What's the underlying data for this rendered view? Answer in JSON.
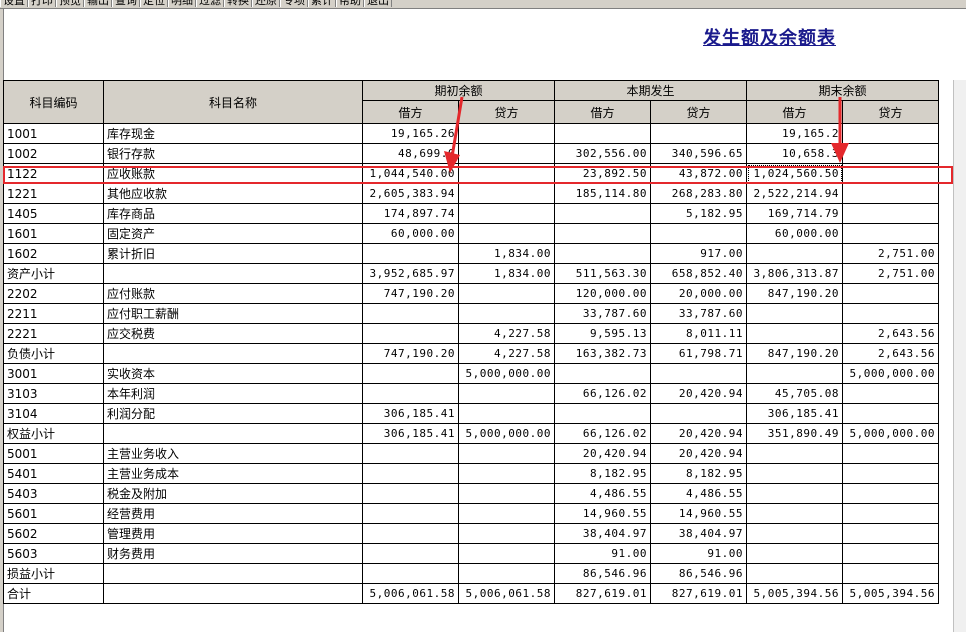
{
  "toolbar": {
    "buttons": [
      "设置",
      "打印",
      "预览",
      "输出",
      "查询",
      "定位",
      "明细",
      "过滤",
      "转换",
      "还原",
      "专项",
      "累计",
      "帮助",
      "退出"
    ]
  },
  "report": {
    "title": "发生额及余额表"
  },
  "table": {
    "headers": {
      "code": "科目编码",
      "name": "科目名称",
      "opening": "期初余额",
      "current": "本期发生",
      "closing": "期末余额",
      "debit": "借方",
      "credit": "贷方"
    },
    "rows": [
      {
        "code": "1001",
        "name": "库存现金",
        "od": "19,165.26",
        "oc": "",
        "cd": "",
        "cc": "",
        "ed": "19,165.2",
        "ec": ""
      },
      {
        "code": "1002",
        "name": "银行存款",
        "od": "48,699.0",
        "oc": "",
        "cd": "302,556.00",
        "cc": "340,596.65",
        "ed": "10,658.3",
        "ec": ""
      },
      {
        "code": "1122",
        "name": "应收账款",
        "od": "1,044,540.00",
        "oc": "",
        "cd": "23,892.50",
        "cc": "43,872.00",
        "ed": "1,024,560.50",
        "ec": ""
      },
      {
        "code": "1221",
        "name": "其他应收款",
        "od": "2,605,383.94",
        "oc": "",
        "cd": "185,114.80",
        "cc": "268,283.80",
        "ed": "2,522,214.94",
        "ec": ""
      },
      {
        "code": "1405",
        "name": "库存商品",
        "od": "174,897.74",
        "oc": "",
        "cd": "",
        "cc": "5,182.95",
        "ed": "169,714.79",
        "ec": ""
      },
      {
        "code": "1601",
        "name": "固定资产",
        "od": "60,000.00",
        "oc": "",
        "cd": "",
        "cc": "",
        "ed": "60,000.00",
        "ec": ""
      },
      {
        "code": "1602",
        "name": "累计折旧",
        "od": "",
        "oc": "1,834.00",
        "cd": "",
        "cc": "917.00",
        "ed": "",
        "ec": "2,751.00"
      },
      {
        "code": "资产小计",
        "name": "",
        "od": "3,952,685.97",
        "oc": "1,834.00",
        "cd": "511,563.30",
        "cc": "658,852.40",
        "ed": "3,806,313.87",
        "ec": "2,751.00"
      },
      {
        "code": "2202",
        "name": "应付账款",
        "od": "747,190.20",
        "oc": "",
        "cd": "120,000.00",
        "cc": "20,000.00",
        "ed": "847,190.20",
        "ec": ""
      },
      {
        "code": "2211",
        "name": "应付职工薪酬",
        "od": "",
        "oc": "",
        "cd": "33,787.60",
        "cc": "33,787.60",
        "ed": "",
        "ec": ""
      },
      {
        "code": "2221",
        "name": "应交税费",
        "od": "",
        "oc": "4,227.58",
        "cd": "9,595.13",
        "cc": "8,011.11",
        "ed": "",
        "ec": "2,643.56"
      },
      {
        "code": "负债小计",
        "name": "",
        "od": "747,190.20",
        "oc": "4,227.58",
        "cd": "163,382.73",
        "cc": "61,798.71",
        "ed": "847,190.20",
        "ec": "2,643.56"
      },
      {
        "code": "3001",
        "name": "实收资本",
        "od": "",
        "oc": "5,000,000.00",
        "cd": "",
        "cc": "",
        "ed": "",
        "ec": "5,000,000.00"
      },
      {
        "code": "3103",
        "name": "本年利润",
        "od": "",
        "oc": "",
        "cd": "66,126.02",
        "cc": "20,420.94",
        "ed": "45,705.08",
        "ec": ""
      },
      {
        "code": "3104",
        "name": "利润分配",
        "od": "306,185.41",
        "oc": "",
        "cd": "",
        "cc": "",
        "ed": "306,185.41",
        "ec": ""
      },
      {
        "code": "权益小计",
        "name": "",
        "od": "306,185.41",
        "oc": "5,000,000.00",
        "cd": "66,126.02",
        "cc": "20,420.94",
        "ed": "351,890.49",
        "ec": "5,000,000.00"
      },
      {
        "code": "5001",
        "name": "主营业务收入",
        "od": "",
        "oc": "",
        "cd": "20,420.94",
        "cc": "20,420.94",
        "ed": "",
        "ec": ""
      },
      {
        "code": "5401",
        "name": "主营业务成本",
        "od": "",
        "oc": "",
        "cd": "8,182.95",
        "cc": "8,182.95",
        "ed": "",
        "ec": ""
      },
      {
        "code": "5403",
        "name": "税金及附加",
        "od": "",
        "oc": "",
        "cd": "4,486.55",
        "cc": "4,486.55",
        "ed": "",
        "ec": ""
      },
      {
        "code": "5601",
        "name": "经营费用",
        "od": "",
        "oc": "",
        "cd": "14,960.55",
        "cc": "14,960.55",
        "ed": "",
        "ec": ""
      },
      {
        "code": "5602",
        "name": "管理费用",
        "od": "",
        "oc": "",
        "cd": "38,404.97",
        "cc": "38,404.97",
        "ed": "",
        "ec": ""
      },
      {
        "code": "5603",
        "name": "财务费用",
        "od": "",
        "oc": "",
        "cd": "91.00",
        "cc": "91.00",
        "ed": "",
        "ec": ""
      },
      {
        "code": "损益小计",
        "name": "",
        "od": "",
        "oc": "",
        "cd": "86,546.96",
        "cc": "86,546.96",
        "ed": "",
        "ec": ""
      },
      {
        "code": "合计",
        "name": "",
        "od": "5,006,061.58",
        "oc": "5,006,061.58",
        "cd": "827,619.01",
        "cc": "827,619.01",
        "ed": "5,005,394.56",
        "ec": "5,005,394.56"
      }
    ]
  },
  "annotations": {
    "highlight_color": "#e4282c",
    "highlighted_row_code": "1122",
    "arrow_icon": "red-arrow-icon"
  }
}
